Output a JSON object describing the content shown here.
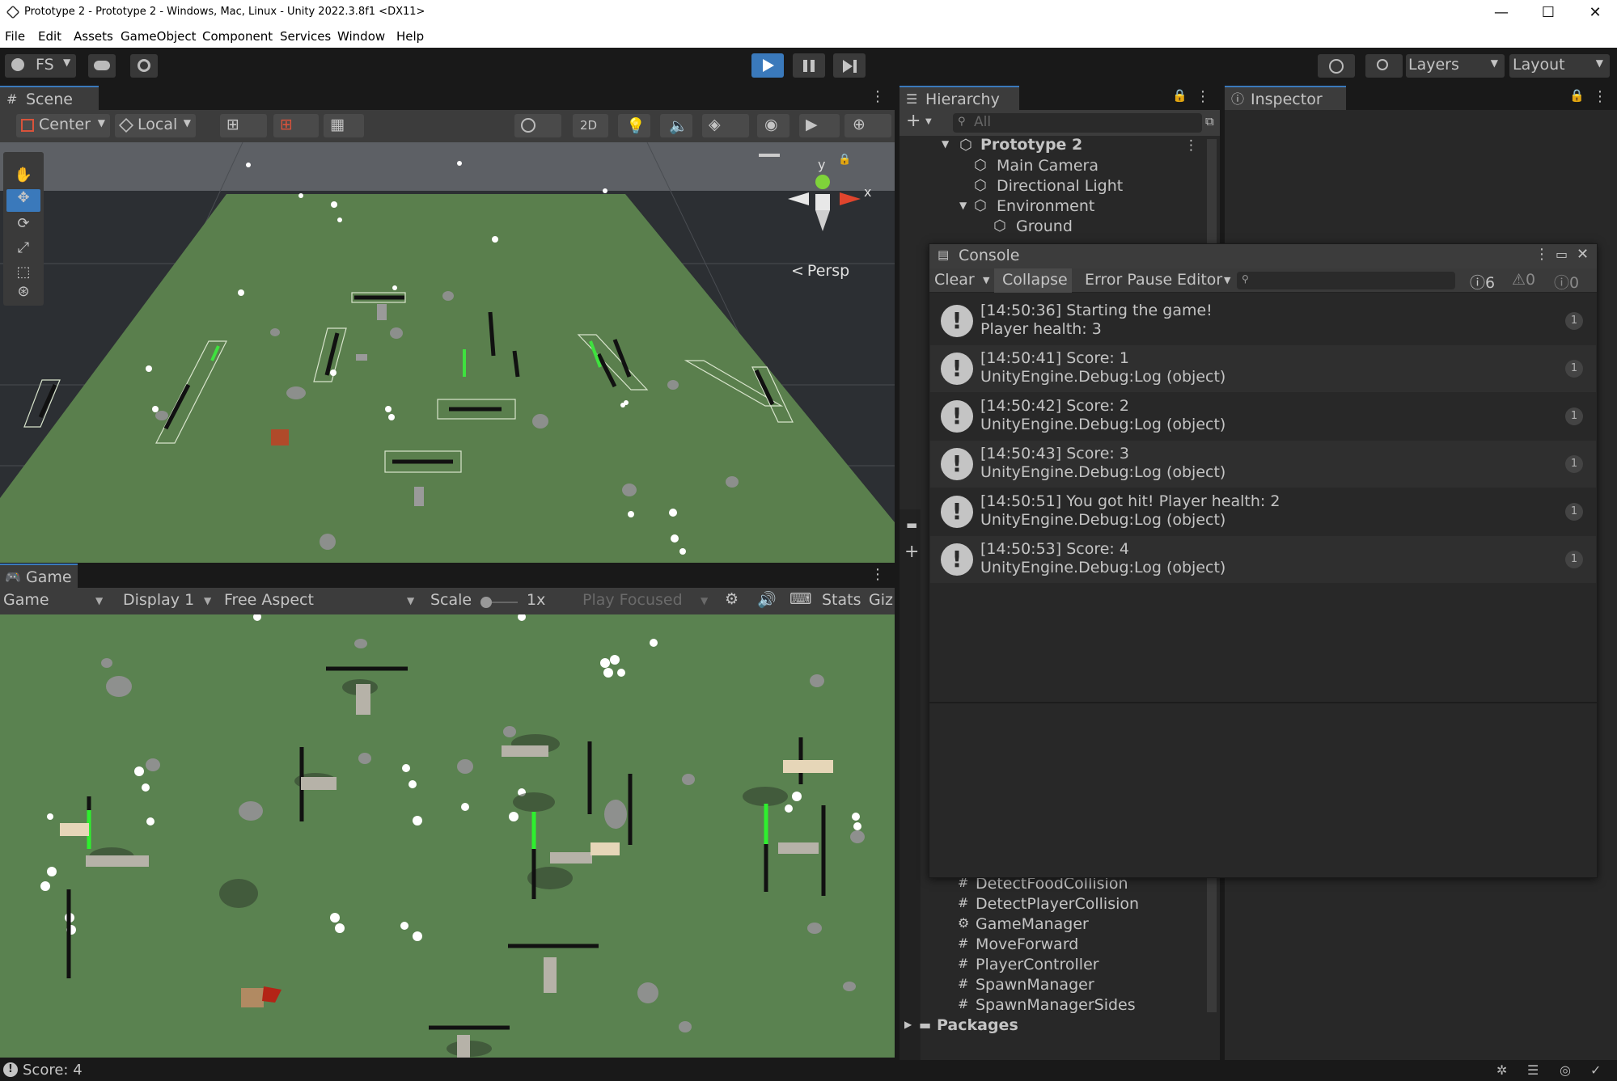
{
  "window": {
    "title": "Prototype 2 - Prototype 2 - Windows, Mac, Linux - Unity 2022.3.8f1 <DX11>",
    "minimize": "—",
    "maximize": "☐",
    "close": "✕"
  },
  "menu": [
    "File",
    "Edit",
    "Assets",
    "GameObject",
    "Component",
    "Services",
    "Window",
    "Help"
  ],
  "toolbar": {
    "account": "FS",
    "layers_label": "Layers",
    "layout_label": "Layout"
  },
  "scene": {
    "tab_label": "Scene",
    "pivot_label": "Center",
    "space_label": "Local",
    "mode_2d": "2D",
    "persp_label": "Persp",
    "gizmo_y": "y",
    "gizmo_x": "x"
  },
  "game": {
    "tab_label": "Game",
    "view_label": "Game",
    "display_label": "Display 1",
    "aspect_label": "Free Aspect",
    "scale_label": "Scale",
    "scale_value": "1x",
    "play_focused_label": "Play Focused",
    "stats_label": "Stats",
    "gizmos_label": "Giz"
  },
  "hierarchy": {
    "tab_label": "Hierarchy",
    "search_placeholder": "All",
    "scene_name": "Prototype 2",
    "items": [
      "Main Camera",
      "Directional Light",
      "Environment",
      "Ground"
    ]
  },
  "inspector": {
    "tab_label": "Inspector"
  },
  "project": {
    "assets": [
      "DetectFoodCollision",
      "DetectPlayerCollision",
      "GameManager",
      "MoveForward",
      "PlayerController",
      "SpawnManager",
      "SpawnManagerSides"
    ],
    "packages_label": "Packages"
  },
  "console": {
    "title": "Console",
    "clear_label": "Clear",
    "collapse_label": "Collapse",
    "error_pause_label": "Error Pause",
    "editor_label": "Editor",
    "log_count": "6",
    "warn_count": "0",
    "error_count": "0",
    "entries": [
      {
        "line1": "[14:50:36] Starting the game!",
        "line2": "Player health: 3",
        "count": "1"
      },
      {
        "line1": "[14:50:41] Score: 1",
        "line2": "UnityEngine.Debug:Log (object)",
        "count": "1"
      },
      {
        "line1": "[14:50:42] Score: 2",
        "line2": "UnityEngine.Debug:Log (object)",
        "count": "1"
      },
      {
        "line1": "[14:50:43] Score: 3",
        "line2": "UnityEngine.Debug:Log (object)",
        "count": "1"
      },
      {
        "line1": "[14:50:51] You got hit! Player health: 2",
        "line2": "UnityEngine.Debug:Log (object)",
        "count": "1"
      },
      {
        "line1": "[14:50:53] Score: 4",
        "line2": "UnityEngine.Debug:Log (object)",
        "count": "1"
      }
    ]
  },
  "status": {
    "message": "Score: 4"
  }
}
